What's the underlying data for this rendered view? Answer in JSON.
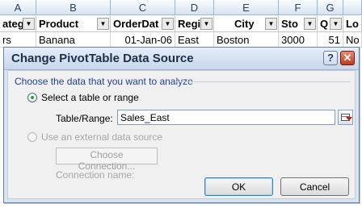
{
  "sheet": {
    "columns": [
      "A",
      "B",
      "C",
      "D",
      "E",
      "F",
      "G"
    ],
    "headers": [
      "atego",
      "Product",
      "OrderDat",
      "Regio",
      "City",
      "Sto",
      "Q",
      "Lo"
    ],
    "row": [
      "rs",
      "Banana",
      "01-Jan-06",
      "East",
      "Boston",
      "3000",
      "51",
      "No"
    ]
  },
  "dialog": {
    "title": "Change PivotTable Data Source",
    "help": "?",
    "close": "✕",
    "group_label": "Choose the data that you want to analyze",
    "radio_table": "Select a table or range",
    "table_range_label": "Table/Range:",
    "table_range_value": "Sales_East",
    "radio_external": "Use an external data source",
    "choose_connection": "Choose Connection...",
    "connection_name_label": "Connection name:",
    "ok": "OK",
    "cancel": "Cancel"
  },
  "icons": {
    "collapse": "collapse-dialog-icon",
    "help": "help-icon",
    "close": "close-icon"
  }
}
